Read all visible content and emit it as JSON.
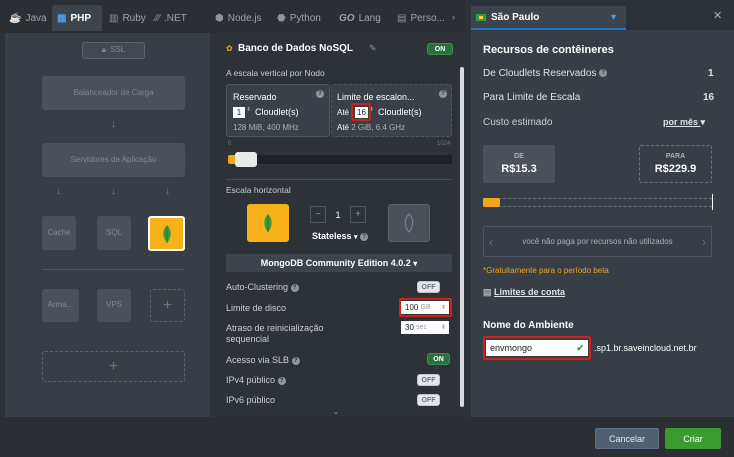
{
  "tabs": [
    {
      "label": "Java",
      "icon": "java-icon"
    },
    {
      "label": "PHP",
      "icon": "php-icon"
    },
    {
      "label": "Ruby",
      "icon": "ruby-icon"
    },
    {
      "label": ".NET",
      "icon": "dotnet-icon"
    },
    {
      "label": "Node.js",
      "icon": "nodejs-icon"
    },
    {
      "label": "Python",
      "icon": "python-icon"
    },
    {
      "label": "Lang",
      "icon": "go-icon",
      "prefix": "GO"
    },
    {
      "label": "Perso...",
      "icon": "custom-icon"
    }
  ],
  "topology": {
    "ssl": "SSL",
    "balancer": "Balanceador de Carga",
    "app_servers": "Servidores de Aplicação",
    "cache": "Cache",
    "sql": "SQL",
    "storage": "Arma...",
    "vps": "VPS"
  },
  "config": {
    "title": "Banco de Dados NoSQL",
    "title_toggle": "ON",
    "vertical_scaling_label": "A escala vertical por Nodo",
    "reserved_label": "Reservado",
    "reserved_value": "1",
    "reserved_unit": "Cloudlet(s)",
    "reserved_sub": "128 MiB, 400 MHz",
    "limit_label": "Limite de escalon...",
    "limit_prefix": "Até",
    "limit_value": "16",
    "limit_unit": "Cloudlet(s)",
    "limit_sub_prefix": "Até",
    "limit_sub": "2 GiB, 6.4 GHz",
    "slider_min": "0",
    "slider_max": "1024",
    "horizontal_label": "Escala horizontal",
    "node_count": "1",
    "stateless": "Stateless",
    "version": "MongoDB Community Edition 4.0.2",
    "auto_clustering_label": "Auto-Clustering",
    "auto_clustering": "OFF",
    "disk_label": "Limite de disco",
    "disk_value": "100",
    "disk_unit": "GB",
    "restart_label_1": "Atraso de reinicialização",
    "restart_label_2": "sequencial",
    "restart_value": "30",
    "restart_unit": "sec",
    "slb_label": "Acesso via SLB",
    "slb": "ON",
    "ipv4_label": "IPv4 público",
    "ipv4": "OFF",
    "ipv6_label": "IPv6 público",
    "ipv6": "OFF"
  },
  "right": {
    "region": "São Paulo",
    "resources_title": "Recursos de contêineres",
    "reserved_label_pre": "De",
    "reserved_label": "Cloudlets Reservados",
    "reserved_value": "1",
    "limit_label_pre": "Para",
    "limit_label": "Limite de Escala",
    "limit_value": "16",
    "cost_label": "Custo estimado",
    "cost_period": "por mês",
    "from_label": "DE",
    "from_value": "R$15.3",
    "to_label": "PARA",
    "to_value": "R$229.9",
    "not_used_text": "você não paga por recursos não utilizados",
    "free_text": "*Gratuitamente para o período beta",
    "account_limits": "Limites de conta",
    "env_name_title": "Nome do Ambiente",
    "env_name": "envmongo",
    "domain": ".sp1.br.saveincloud.net.br"
  },
  "footer": {
    "cancel": "Cancelar",
    "create": "Criar"
  },
  "colors": {
    "accent_blue": "#1f78c8",
    "green_button": "#3a9c2f",
    "highlight_red": "#d3201d",
    "price_orange": "#f0a91a",
    "note_orange": "#f0a91a"
  }
}
